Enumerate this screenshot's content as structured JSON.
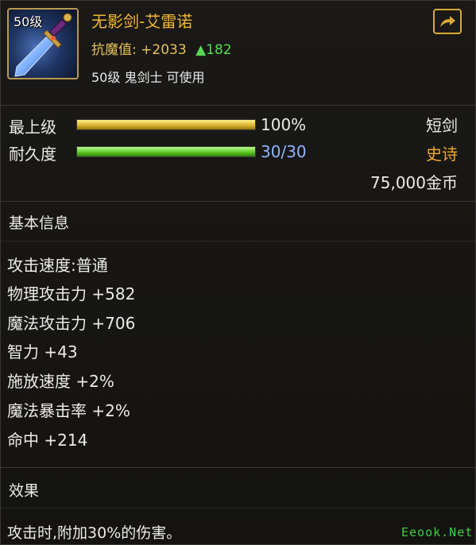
{
  "item": {
    "level_badge": "50级",
    "name": "无影剑-艾雷诺",
    "resist_label": "抗魔值:",
    "resist_value": "+2033",
    "resist_increase": "▲182",
    "requirement": "50级 鬼剑士 可使用"
  },
  "stats": {
    "grade_label": "最上级",
    "grade_value": "100%",
    "grade_fraction": 1.0,
    "durability_label": "耐久度",
    "durability_value": "30/30",
    "durability_fraction": 1.0,
    "weapon_type": "短剑",
    "rarity": "史诗",
    "price": "75,000金币"
  },
  "basic_info": {
    "title": "基本信息",
    "attributes": [
      "攻击速度:普通",
      "物理攻击力 +582",
      "魔法攻击力 +706",
      "智力 +43",
      "施放速度 +2%",
      "魔法暴击率 +2%",
      "命中 +214"
    ]
  },
  "effect": {
    "title": "效果",
    "text": "攻击时,附加30%的伤害。"
  },
  "watermark": "Eeook.Net",
  "colors": {
    "item_name": "#f1b735",
    "rarity_epic": "#f1a92e",
    "resist": "#e7c25a",
    "increase": "#57d957",
    "durability_value": "#8fb6ff",
    "grade_bar": "#d7b12c",
    "durability_bar": "#57c21e"
  }
}
